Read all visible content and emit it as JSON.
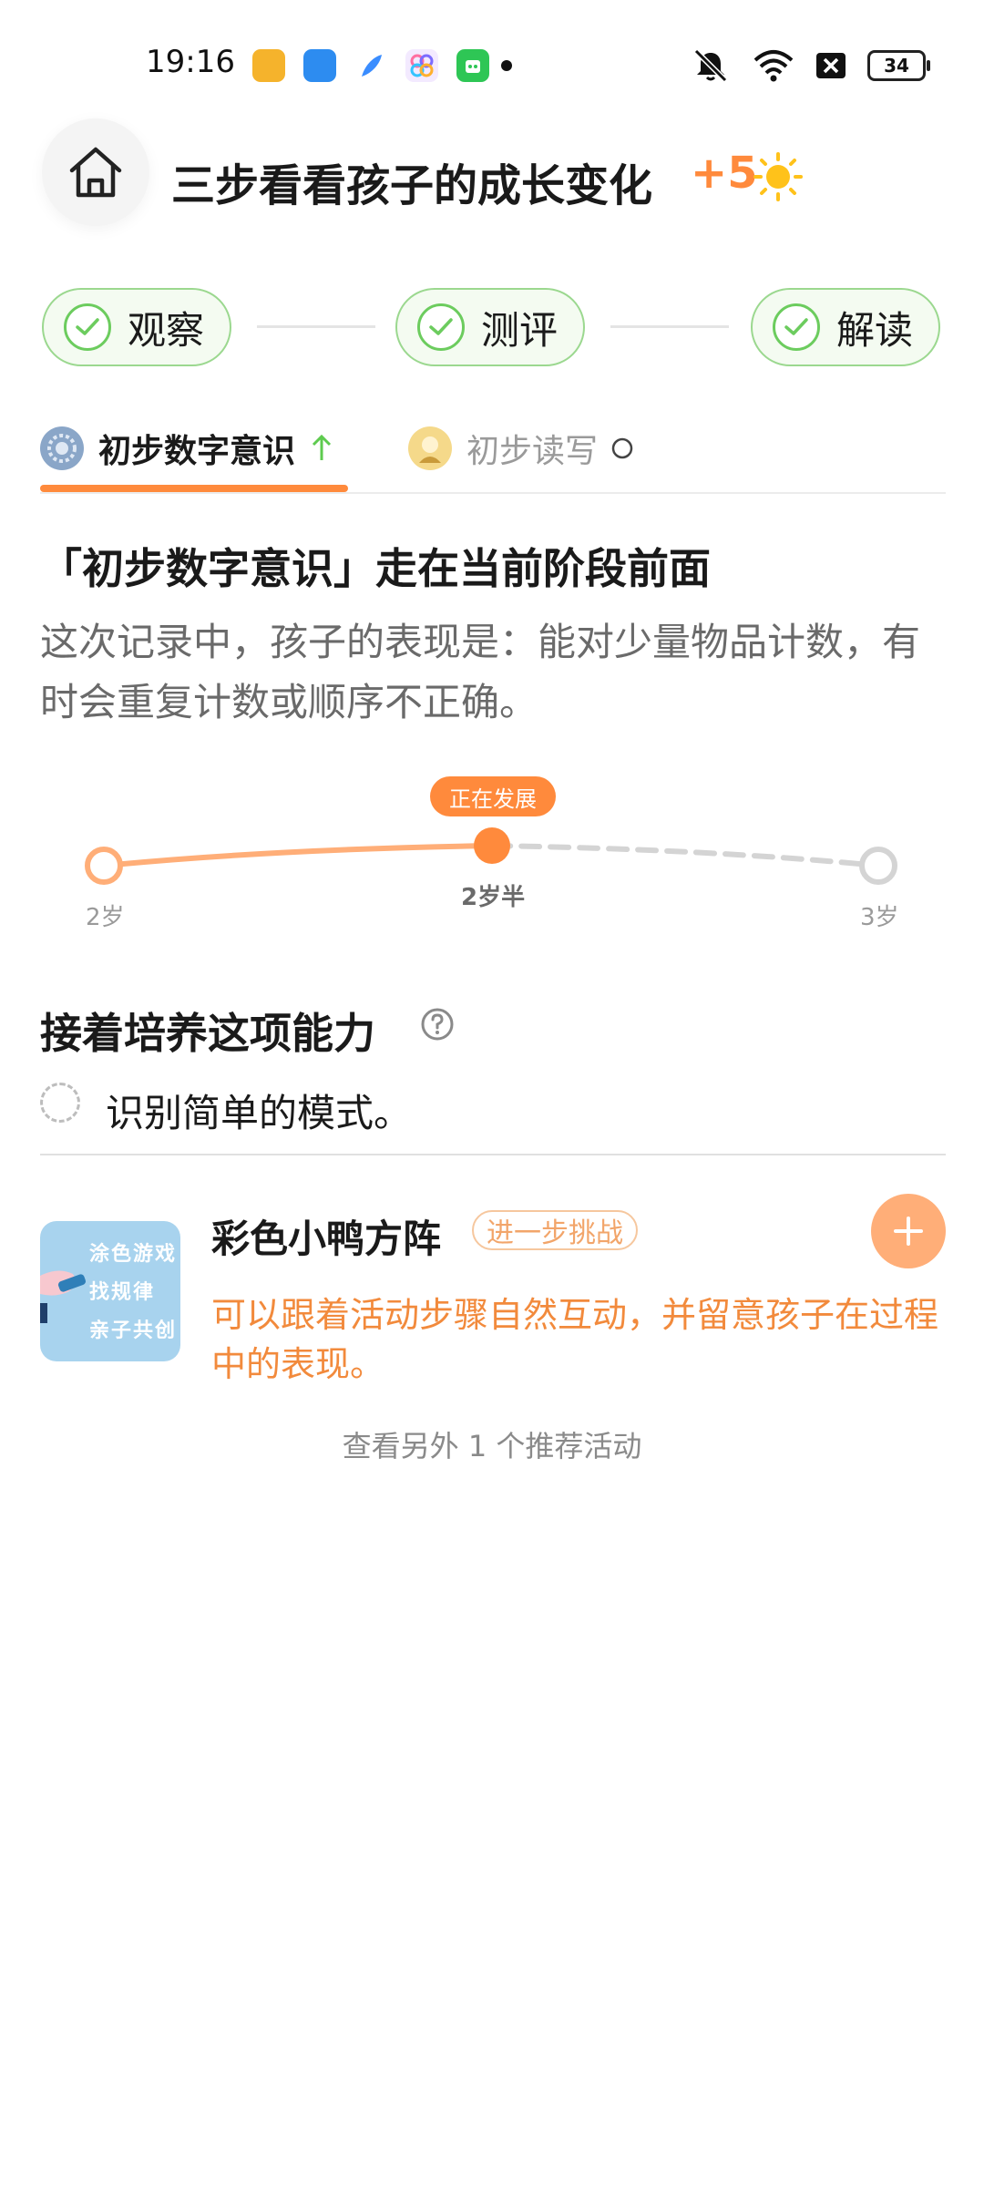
{
  "status_bar": {
    "time": "19:16",
    "battery": "34",
    "app_icons": [
      {
        "name": "book-app-icon",
        "color": "#f5b32c"
      },
      {
        "name": "window-app-icon",
        "color": "#2d8cf0"
      },
      {
        "name": "feather-app-icon",
        "color": "#3a8dff"
      },
      {
        "name": "flower-app-icon",
        "color": "#f0e6ff"
      },
      {
        "name": "game-app-icon",
        "color": "#2ec655"
      }
    ]
  },
  "header": {
    "title": "三步看看孩子的成长变化",
    "points": "+5"
  },
  "steps": [
    {
      "label": "观察"
    },
    {
      "label": "测评"
    },
    {
      "label": "解读"
    }
  ],
  "tabs": [
    {
      "label": "初步数字意识",
      "active": true
    },
    {
      "label": "初步读写",
      "active": false
    }
  ],
  "summary": {
    "title": "「初步数字意识」走在当前阶段前面",
    "description": "这次记录中，孩子的表现是：能对少量物品计数，有时会重复计数或顺序不正确。"
  },
  "progress": {
    "badge": "正在发展",
    "start_label": "2岁",
    "current_label": "2岁半",
    "end_label": "3岁"
  },
  "next": {
    "title": "接着培养这项能力",
    "task": "识别简单的模式。"
  },
  "activity": {
    "name": "彩色小鸭方阵",
    "tag": "进一步挑战",
    "description": "可以跟着活动步骤自然互动，并留意孩子在过程中的表现。",
    "thumb_lines": [
      "涂色游戏",
      "找规律",
      "亲子共创"
    ],
    "more_link": "查看另外 1 个推荐活动"
  },
  "colors": {
    "accent": "#ff8a3c",
    "step_green": "#6ccc5e",
    "track": "#ffae78"
  }
}
